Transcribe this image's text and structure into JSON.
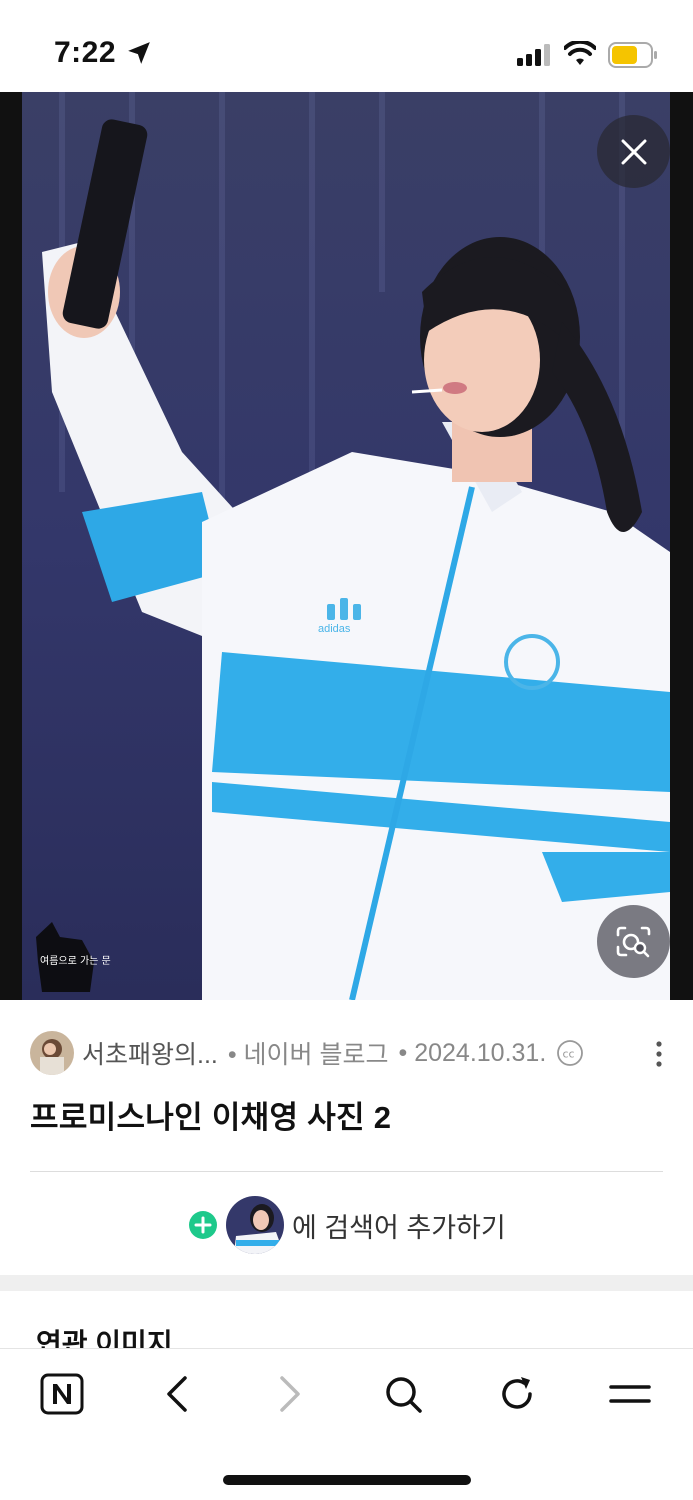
{
  "status_bar": {
    "time": "7:22"
  },
  "photo": {
    "watermark": "여름으로 가는 문"
  },
  "source": {
    "blog_name": "서초패왕의...",
    "platform": "• 네이버 블로그",
    "date": "• 2024.10.31."
  },
  "title": "프로미스나인 이채영 사진 2",
  "add_search": {
    "label": "에 검색어 추가하기"
  },
  "related": {
    "heading": "연관 이미지"
  },
  "colors": {
    "accent_green": "#1ec98b",
    "battery_yellow": "#f5c400"
  },
  "toolbar": {
    "items": [
      "naver-home-icon",
      "back-icon",
      "forward-icon",
      "search-icon",
      "refresh-icon",
      "menu-icon"
    ]
  }
}
